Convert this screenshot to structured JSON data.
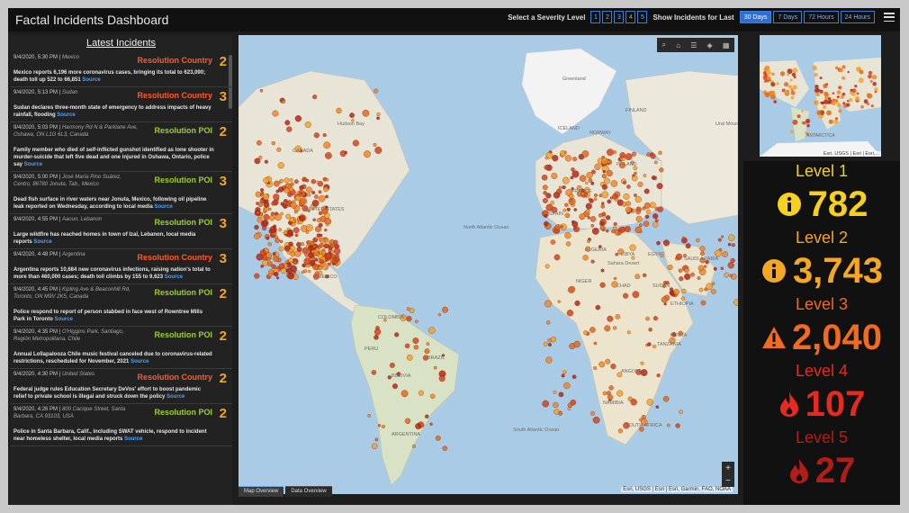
{
  "app": {
    "title": "Factal Incidents Dashboard"
  },
  "controls": {
    "severity_label": "Select a Severity Level",
    "severity_levels": [
      "1",
      "2",
      "3",
      "4",
      "5"
    ],
    "time_label": "Show Incidents for Last",
    "time_options": [
      "30 Days",
      "7 Days",
      "72 Hours",
      "24 Hours"
    ],
    "time_selected": "30 Days"
  },
  "sidebar": {
    "title": "Latest Incidents",
    "source_label": "Source",
    "incidents": [
      {
        "time": "9/4/2020, 5:30 PM",
        "location": "Mexico",
        "type": "Resolution Country",
        "type_kind": "country",
        "level": "2",
        "headline": "Mexico reports 6,196 more coronavirus cases, bringing its total to 623,090; death toll up 522 to 66,851"
      },
      {
        "time": "9/4/2020, 5:13 PM",
        "location": "Sudan",
        "type": "Resolution Country",
        "type_kind": "country",
        "level": "3",
        "headline": "Sudan declares three-month state of emergency to address impacts of heavy rainfall, flooding"
      },
      {
        "time": "9/4/2020, 5:03 PM",
        "location": "Harmony Rd N & Parklane Ave, Oshawa, ON L1G 6L3, Canada",
        "type": "Resolution POI",
        "type_kind": "poi",
        "level": "2",
        "headline": "Family member who died of self-inflicted gunshot identified as lone shooter in murder-suicide that left five dead and one injured in Oshawa, Ontario, police say"
      },
      {
        "time": "9/4/2020, 5:00 PM",
        "location": "José María Pino Suárez, Centro, 86780 Jonuta, Tab., Mexico",
        "type": "Resolution POI",
        "type_kind": "poi",
        "level": "3",
        "headline": "Dead fish surface in river waters near Jonuta, Mexico, following oil pipeline leak reported on Wednesday, according to local media"
      },
      {
        "time": "9/4/2020, 4:55 PM",
        "location": "Aaoun, Lebanon",
        "type": "Resolution POI",
        "type_kind": "poi",
        "level": "3",
        "headline": "Large wildfire has reached homes in town of Izal, Lebanon, local media reports"
      },
      {
        "time": "9/4/2020, 4:48 PM",
        "location": "Argentina",
        "type": "Resolution Country",
        "type_kind": "country",
        "level": "3",
        "headline": "Argentina reports 10,684 new coronavirus infections, raising nation's total to more than 460,000 cases; death toll climbs by 155 to 9,623"
      },
      {
        "time": "9/4/2020, 4:45 PM",
        "location": "Kipling Ave & Beaconhill Rd, Toronto, ON M9V 2K5, Canada",
        "type": "Resolution POI",
        "type_kind": "poi",
        "level": "2",
        "headline": "Police respond to report of person stabbed in face west of Rowntree Mills Park in Toronto"
      },
      {
        "time": "9/4/2020, 4:35 PM",
        "location": "O'Higgins Park, Santiago, Región Metropolitana, Chile",
        "type": "Resolution POI",
        "type_kind": "poi",
        "level": "2",
        "headline": "Annual Lollapalooza Chile music festival canceled due to coronavirus-related restrictions, rescheduled for November, 2021"
      },
      {
        "time": "9/4/2020, 4:30 PM",
        "location": "United States",
        "type": "Resolution Country",
        "type_kind": "country",
        "level": "2",
        "headline": "Federal judge rules Education Secretary DeVos' effort to boost pandemic relief to private school is illegal and struck down the policy"
      },
      {
        "time": "9/4/2020, 4:26 PM",
        "location": "800 Cacique Street, Santa Barbara, CA 93103, USA",
        "type": "Resolution POI",
        "type_kind": "poi",
        "level": "2",
        "headline": "Police in Santa Barbara, Calif., including SWAT vehicle, respond to incident near homeless shelter, local media reports"
      }
    ]
  },
  "map": {
    "attribution": "Esri, USGS | Esri | Esri, Garmin, FAO, NOAA",
    "labels": [
      "CANADA",
      "UNITED STATES",
      "MEXICO",
      "BRAZIL",
      "PERU",
      "ARGENTINA",
      "COLOMBIA",
      "BOLIVIA",
      "North Atlantic Ocean",
      "South Atlantic Ocean",
      "Greenland",
      "ICELAND",
      "FINLAND",
      "NORWAY",
      "POLAND",
      "FRANCE",
      "SPAIN",
      "ALGERIA",
      "LIBYA",
      "EGYPT",
      "NIGER",
      "CHAD",
      "SUDAN",
      "Sahara Desert",
      "ETHIOPIA",
      "KENYA",
      "ANGOLA",
      "NAMIBIA",
      "SOUTH AFRICA",
      "SAUDI ARABIA",
      "TANZANIA",
      "Hudson Bay",
      "Ural Mountains"
    ],
    "tabs": [
      "Map Overview",
      "Data Overview"
    ],
    "active_tab": "Map Overview"
  },
  "overview_map": {
    "attribution": "Esri, USGS | Esri | Esri,...",
    "label": "ANTARCTICA"
  },
  "levels": [
    {
      "title": "Level 1",
      "count": "782",
      "color": "#f5d020",
      "icon": "info-circle-icon"
    },
    {
      "title": "Level 2",
      "count": "3,743",
      "color": "#f5a623",
      "icon": "info-circle-icon"
    },
    {
      "title": "Level 3",
      "count": "2,040",
      "color": "#f06a1f",
      "icon": "warning-triangle-icon"
    },
    {
      "title": "Level 4",
      "count": "107",
      "color": "#e52b1f",
      "icon": "fire-icon"
    },
    {
      "title": "Level 5",
      "count": "27",
      "color": "#b21e17",
      "icon": "fire-icon"
    }
  ]
}
